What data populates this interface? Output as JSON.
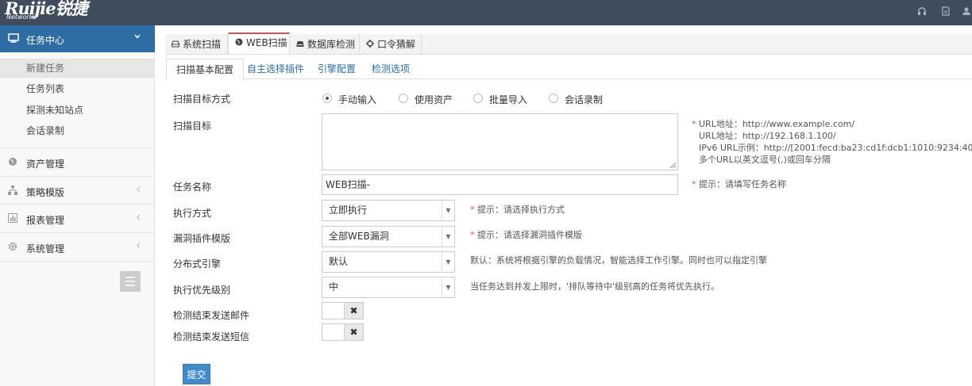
{
  "header": {
    "brand": "Ruijie锐捷",
    "brand_sub": "Networks",
    "icons": [
      "headset-icon",
      "document-icon",
      "user-icon"
    ]
  },
  "sidebar": {
    "active_menu": {
      "label": "任务中心",
      "icon": "monitor-icon"
    },
    "sub_items": [
      {
        "label": "新建任务",
        "selected": true
      },
      {
        "label": "任务列表"
      },
      {
        "label": "探测未知站点"
      },
      {
        "label": "会话录制"
      }
    ],
    "menus": [
      {
        "label": "资产管理",
        "icon": "globe-icon"
      },
      {
        "label": "策略模版",
        "icon": "sitemap-icon"
      },
      {
        "label": "报表管理",
        "icon": "bar-chart-icon"
      },
      {
        "label": "系统管理",
        "icon": "gear-icon"
      }
    ]
  },
  "tabs": [
    {
      "label": "系统扫描",
      "icon": "hdd-icon"
    },
    {
      "label": "WEB扫描",
      "icon": "globe-icon",
      "active": true
    },
    {
      "label": "数据库检测",
      "icon": "database-icon"
    },
    {
      "label": "口令猜解",
      "icon": "crosshair-icon"
    }
  ],
  "subtabs": [
    {
      "label": "扫描基本配置",
      "active": true
    },
    {
      "label": "自主选择插件"
    },
    {
      "label": "引擎配置"
    },
    {
      "label": "检测选项"
    }
  ],
  "form": {
    "target_mode": {
      "label": "扫描目标方式",
      "options": [
        {
          "label": "手动输入",
          "checked": true
        },
        {
          "label": "使用资产"
        },
        {
          "label": "批量导入"
        },
        {
          "label": "会话录制"
        }
      ]
    },
    "target": {
      "label": "扫描目标",
      "value": "",
      "hints": [
        "URL地址：http://www.example.com/",
        "URL地址：http://192.168.1.100/",
        "IPv6 URL示例：http://[2001:fecd:ba23:cd1f:dcb1:1010:9234:4088]/",
        "多个URL以英文逗号(,)或回车分隔"
      ]
    },
    "task_name": {
      "label": "任务名称",
      "value": "WEB扫描-",
      "hint": "提示：请填写任务名称"
    },
    "exec_mode": {
      "label": "执行方式",
      "value": "立即执行",
      "hint": "提示：请选择执行方式"
    },
    "plugin_template": {
      "label": "漏洞插件模版",
      "value": "全部WEB漏洞",
      "hint": "提示：请选择漏洞插件模版"
    },
    "engine": {
      "label": "分布式引擎",
      "value": "默认",
      "hint": "默认：系统将根据引擎的负载情况，智能选择工作引擎。同时也可以指定引擎"
    },
    "priority": {
      "label": "执行优先级别",
      "value": "中",
      "hint": "当任务达到并发上限时，'排队等待中'级别高的任务将优先执行。"
    },
    "email_notify": {
      "label": "检测结束发送邮件",
      "enabled": false,
      "mark": "✖"
    },
    "sms_notify": {
      "label": "检测结束发送短信",
      "enabled": false,
      "mark": "✖"
    },
    "submit_label": "提交"
  },
  "colors": {
    "header_bg": "#3f4c5d",
    "accent": "#2e6da4",
    "button": "#428bca",
    "required": "#d9534f"
  }
}
